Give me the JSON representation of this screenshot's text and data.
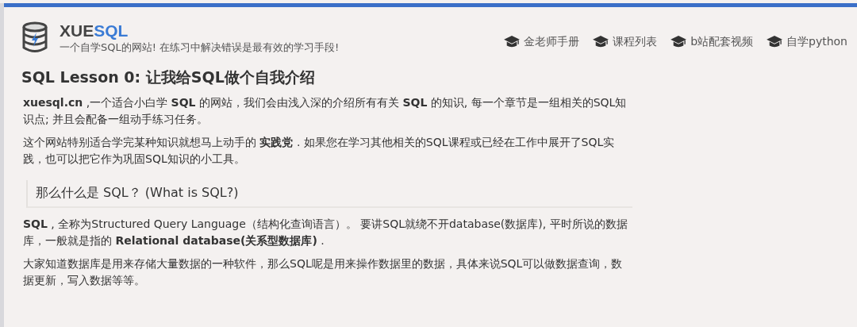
{
  "header": {
    "brand": {
      "dark_part": "XUE",
      "accent_part": "SQL"
    },
    "tagline": "一个自学SQL的网站! 在练习中解决错误是最有效的学习手段!",
    "nav": [
      {
        "label": "金老师手册"
      },
      {
        "label": "课程列表"
      },
      {
        "label": "b站配套视频"
      },
      {
        "label": "自学python"
      }
    ]
  },
  "lesson": {
    "title": "SQL Lesson 0: 让我给SQL做个自我介绍",
    "paragraphs": [
      "**xuesql.cn** ,一个适合小白学 **SQL** 的网站，我们会由浅入深的介绍所有有关 **SQL** 的知识, 每一个章节是一组相关的SQL知识点; 并且会配备一组动手练习任务。",
      "这个网站特别适合学完某种知识就想马上动手的 **实践党** . 如果您在学习其他相关的SQL课程或已经在工作中展开了SQL实践，也可以把它作为巩固SQL知识的小工具。"
    ],
    "section_heading": "那么什么是 SQL？ (What is SQL?)",
    "section_paragraphs": [
      "**SQL** , 全称为Structured Query Language（结构化查询语言）。 要讲SQL就绕不开database(数据库), 平时所说的数据库，一般就是指的 **Relational database(关系型数据库)** .",
      "大家知道数据库是用来存储大量数据的一种软件，那么SQL呢是用来操作数据里的数据，具体来说SQL可以做数据查询，数据更新，写入数据等等。"
    ]
  }
}
